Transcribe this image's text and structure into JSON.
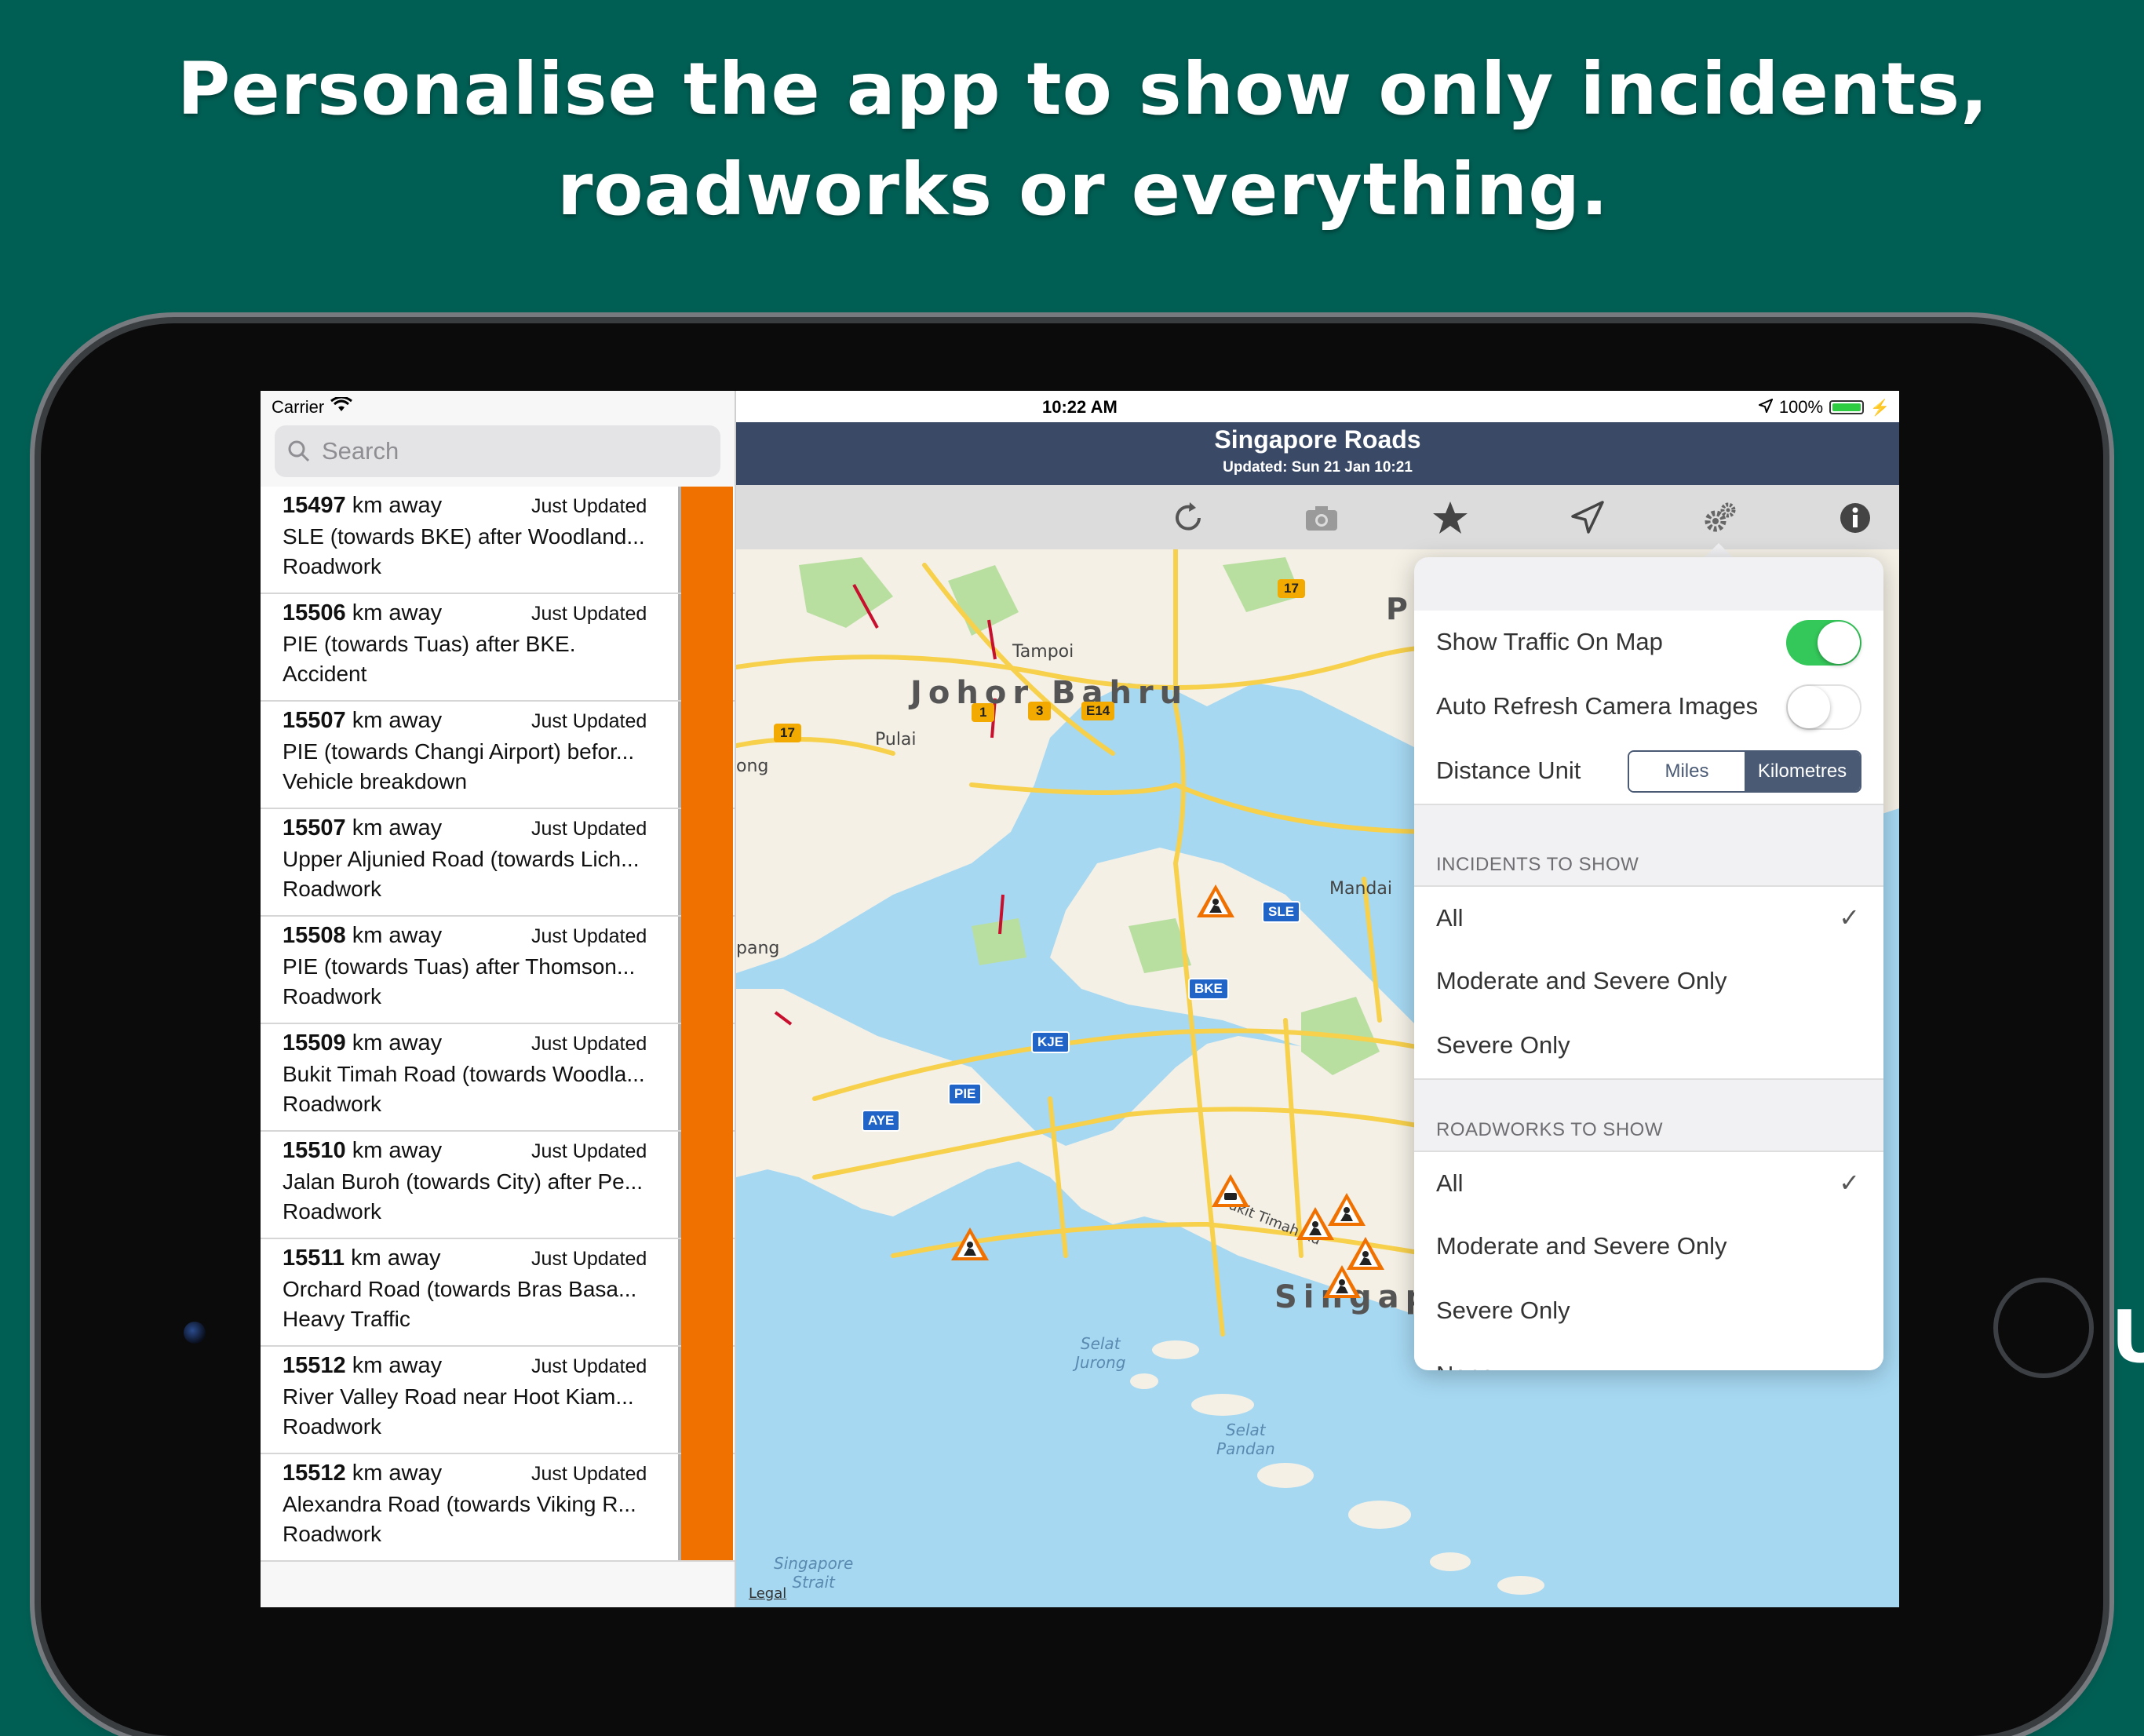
{
  "headline": {
    "line1": "Personalise the app to show only incidents,",
    "line2": "roadworks or everything."
  },
  "edge_text": "U",
  "status_bar": {
    "carrier": "Carrier",
    "time": "10:22 AM",
    "battery": "100%"
  },
  "search": {
    "placeholder": "Search"
  },
  "incidents": [
    {
      "distance": "15497",
      "unit": "km away",
      "updated": "Just Updated",
      "title": "SLE (towards BKE) after Woodland...",
      "type": "Roadwork"
    },
    {
      "distance": "15506",
      "unit": "km away",
      "updated": "Just Updated",
      "title": "PIE (towards Tuas) after BKE.",
      "type": "Accident"
    },
    {
      "distance": "15507",
      "unit": "km away",
      "updated": "Just Updated",
      "title": "PIE (towards Changi Airport) befor...",
      "type": "Vehicle breakdown"
    },
    {
      "distance": "15507",
      "unit": "km away",
      "updated": "Just Updated",
      "title": "Upper Aljunied Road (towards Lich...",
      "type": "Roadwork"
    },
    {
      "distance": "15508",
      "unit": "km away",
      "updated": "Just Updated",
      "title": "PIE (towards Tuas) after Thomson...",
      "type": "Roadwork"
    },
    {
      "distance": "15509",
      "unit": "km away",
      "updated": "Just Updated",
      "title": "Bukit Timah Road (towards Woodla...",
      "type": "Roadwork"
    },
    {
      "distance": "15510",
      "unit": "km away",
      "updated": "Just Updated",
      "title": "Jalan Buroh (towards City) after Pe...",
      "type": "Roadwork"
    },
    {
      "distance": "15511",
      "unit": "km away",
      "updated": "Just Updated",
      "title": "Orchard Road (towards Bras Basa...",
      "type": "Heavy Traffic"
    },
    {
      "distance": "15512",
      "unit": "km away",
      "updated": "Just Updated",
      "title": "River Valley Road near Hoot Kiam...",
      "type": "Roadwork"
    },
    {
      "distance": "15512",
      "unit": "km away",
      "updated": "Just Updated",
      "title": "Alexandra Road (towards Viking R...",
      "type": "Roadwork"
    }
  ],
  "navbar": {
    "title": "Singapore Roads",
    "subtitle": "Updated: Sun 21 Jan 10:21"
  },
  "toolbar": {
    "icons": [
      "refresh-icon",
      "camera-icon",
      "star-icon",
      "location-arrow-icon",
      "gear-icon",
      "info-icon"
    ]
  },
  "map": {
    "labels": {
      "johor": "Johor Bahru",
      "tampoi": "Tampoi",
      "pulai": "Pulai",
      "mandai": "Mandai",
      "singapore": "Singap",
      "selat_jurong": "Selat\nJurong",
      "selat_pandan": "Selat\nPandan",
      "singapore_strait": "Singapore\nStrait",
      "legal": "Legal",
      "ong": "ong",
      "pang": "pang",
      "pl": "Pl",
      "bukit_timah": "Bukit Timah Rd"
    },
    "shields": {
      "sle": "SLE",
      "bke": "BKE",
      "kje": "KJE",
      "pie": "PIE",
      "aye": "AYE",
      "r17a": "17",
      "r17b": "17",
      "r1": "1",
      "r3": "3",
      "e14": "E14"
    }
  },
  "settings": {
    "show_traffic": {
      "label": "Show Traffic On Map",
      "on": true
    },
    "auto_refresh": {
      "label": "Auto Refresh Camera Images",
      "on": false
    },
    "distance_unit": {
      "label": "Distance Unit",
      "options": [
        "Miles",
        "Kilometres"
      ],
      "selected": "Kilometres"
    },
    "incidents_header": "INCIDENTS TO SHOW",
    "incidents_options": [
      "All",
      "Moderate and Severe Only",
      "Severe Only"
    ],
    "incidents_selected": "All",
    "roadworks_header": "ROADWORKS TO SHOW",
    "roadworks_options": [
      "All",
      "Moderate and Severe Only",
      "Severe Only",
      "None"
    ],
    "roadworks_selected": "All",
    "check_mark": "✓"
  },
  "colors": {
    "background": "#005f54",
    "navbar": "#3a4a66",
    "incident_strip": "#f07000",
    "toggle_on": "#34c759",
    "water": "#a6d8f2",
    "land": "#f4f0e6",
    "road": "#f7d04c"
  }
}
